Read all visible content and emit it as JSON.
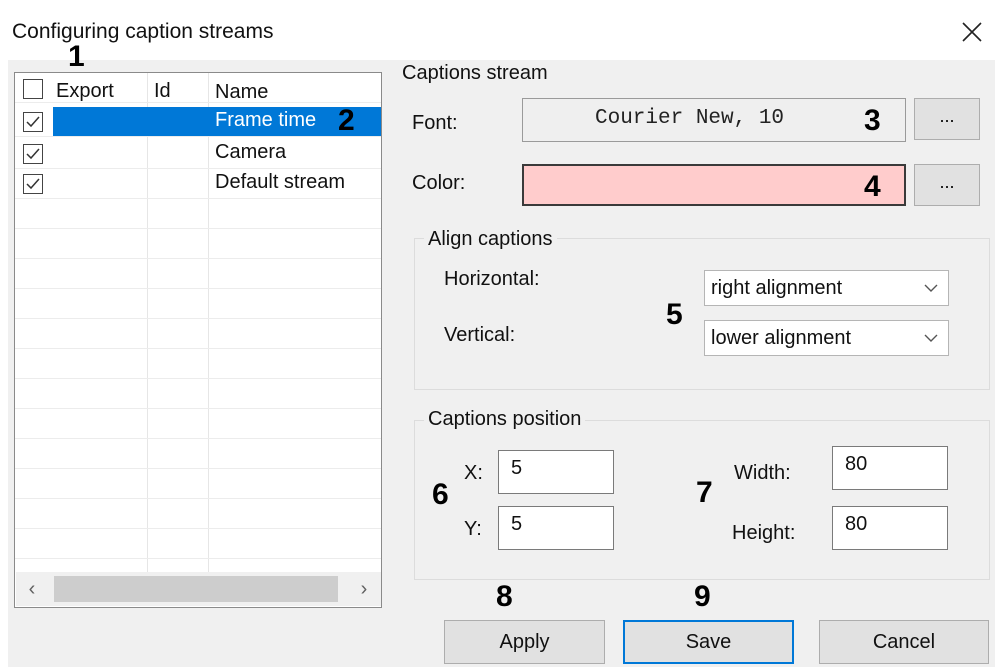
{
  "window": {
    "title": "Configuring caption streams"
  },
  "list": {
    "columns": [
      "Export",
      "Id",
      "Name"
    ],
    "rows": [
      {
        "checked": true,
        "id": "",
        "name": "Frame time",
        "selected": true
      },
      {
        "checked": true,
        "id": "",
        "name": "Camera",
        "selected": false
      },
      {
        "checked": true,
        "id": "",
        "name": "Default stream",
        "selected": false
      }
    ]
  },
  "captions_stream": {
    "group_label": "Captions stream",
    "font_label": "Font:",
    "font_value": "Courier New, 10",
    "font_button": "...",
    "color_label": "Color:",
    "color_value": "#ffcccc",
    "color_button": "..."
  },
  "align": {
    "group_label": "Align captions",
    "horizontal_label": "Horizontal:",
    "horizontal_value": "right alignment",
    "vertical_label": "Vertical:",
    "vertical_value": "lower alignment"
  },
  "position": {
    "group_label": "Captions position",
    "x_label": "X:",
    "x_value": "5",
    "y_label": "Y:",
    "y_value": "5",
    "width_label": "Width:",
    "width_value": "80",
    "height_label": "Height:",
    "height_value": "80"
  },
  "buttons": {
    "apply": "Apply",
    "save": "Save",
    "cancel": "Cancel"
  },
  "callouts": [
    "1",
    "2",
    "3",
    "4",
    "5",
    "6",
    "7",
    "8",
    "9"
  ],
  "colors": {
    "selection": "#0078d7",
    "caption_color": "#ffcccc"
  }
}
